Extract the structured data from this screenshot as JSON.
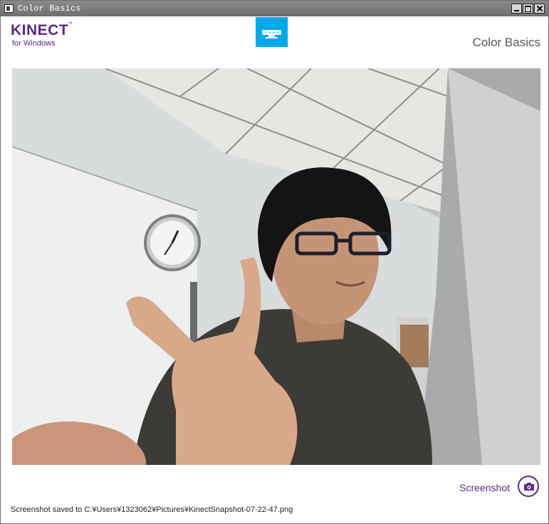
{
  "window": {
    "title": "Color Basics"
  },
  "header": {
    "logo_main": "KINECT",
    "logo_tm": "™",
    "logo_sub": "for Windows",
    "sensor_icon": "kinect-sensor-icon",
    "heading": "Color Basics"
  },
  "camera": {
    "description": "color-camera-feed"
  },
  "actions": {
    "screenshot_label": "Screenshot",
    "screenshot_icon": "camera-icon"
  },
  "status": {
    "text": "Screenshot saved to C:¥Users¥1323062¥Pictures¥KinectSnapshot-07-22-47.png"
  },
  "colors": {
    "brand_purple": "#5d2a82",
    "sensor_blue": "#00a8e8"
  }
}
